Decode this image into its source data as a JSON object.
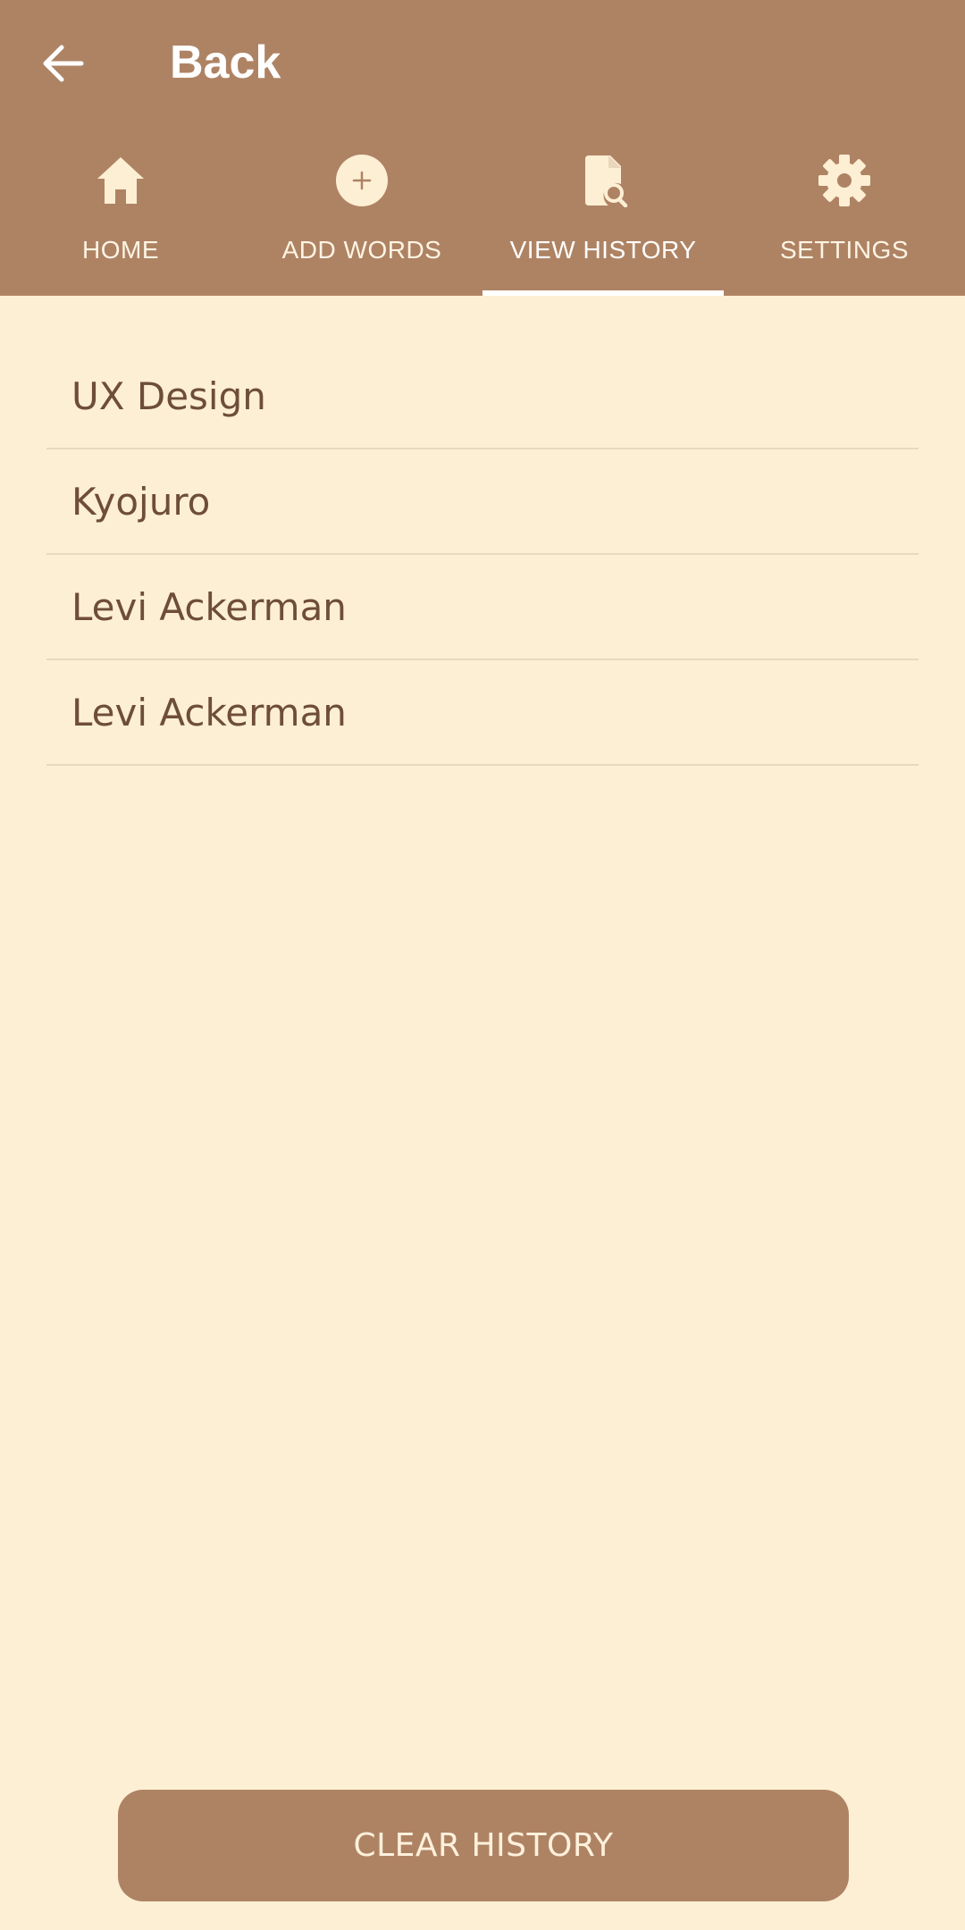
{
  "app_bar": {
    "back_label": "Back",
    "back_icon": "arrow-left-icon",
    "background": "#AE8364"
  },
  "tabs": [
    {
      "label": "HOME",
      "icon": "home-icon",
      "active": false
    },
    {
      "label": "ADD WORDS",
      "icon": "add-circle-icon",
      "active": false
    },
    {
      "label": "VIEW HISTORY",
      "icon": "document-search-icon",
      "active": true
    },
    {
      "label": "SETTINGS",
      "icon": "gear-icon",
      "active": false
    }
  ],
  "history": {
    "items": [
      {
        "label": "UX Design"
      },
      {
        "label": "Kyojuro"
      },
      {
        "label": "Levi Ackerman"
      },
      {
        "label": "Levi Ackerman"
      }
    ]
  },
  "actions": {
    "clear_label": "CLEAR HISTORY"
  },
  "colors": {
    "accent": "#AE8364",
    "background": "#FDEFD4",
    "text": "#6E4D3A",
    "divider": "#E7D8C0"
  }
}
